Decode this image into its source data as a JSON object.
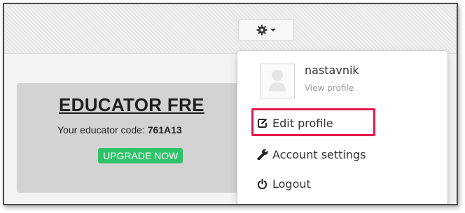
{
  "educator_card": {
    "title": "EDUCATOR FRE",
    "code_label": "Your educator code: ",
    "code_value": "761A13",
    "upgrade_label": "UPGRADE NOW"
  },
  "user_menu": {
    "username": "nastavnik",
    "view_profile": "View profile",
    "items": [
      {
        "label": "Edit profile",
        "icon": "edit-icon"
      },
      {
        "label": "Account settings",
        "icon": "wrench-icon"
      },
      {
        "label": "Logout",
        "icon": "power-icon"
      }
    ]
  },
  "colors": {
    "upgrade_button": "#2ec26a",
    "highlight": "#e3194b",
    "card_background": "#d3d3d3"
  }
}
